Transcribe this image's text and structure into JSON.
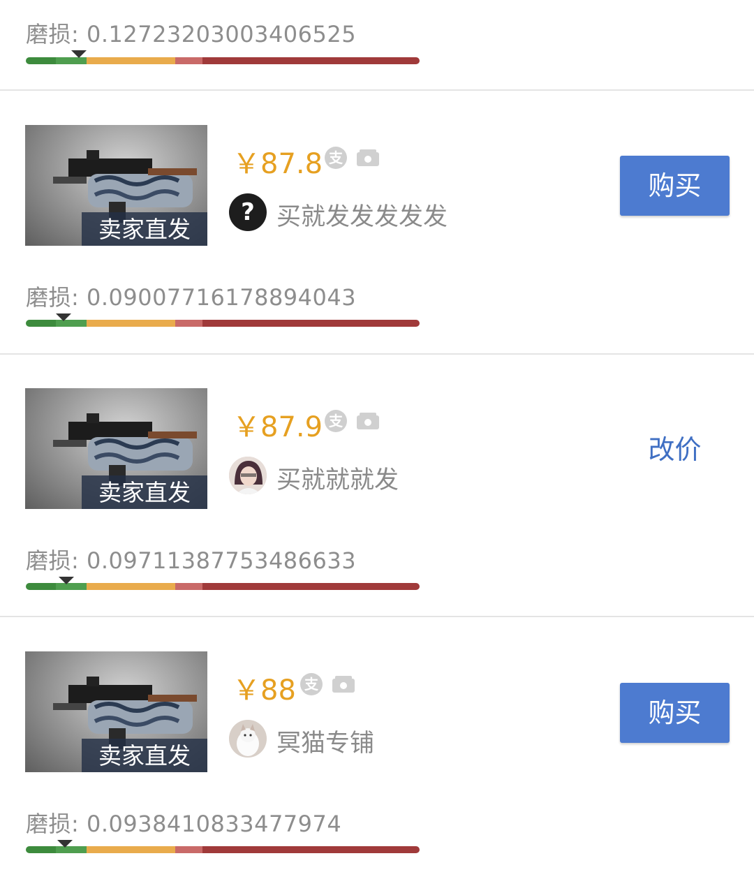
{
  "listings": [
    {
      "wear_label": "磨损: 0.12723203003406525",
      "wear_value": 0.12723203003406525
    },
    {
      "thumb_badge": "卖家直发",
      "price": "￥87.8",
      "pay_icon": "支",
      "seller_icon": "question-icon",
      "seller_name": "买就发发发发发",
      "action_label": "购买",
      "wear_label": "磨损: 0.09007716178894043",
      "wear_value": 0.09007716178894043
    },
    {
      "thumb_badge": "卖家直发",
      "price": "￥87.9",
      "pay_icon": "支",
      "seller_icon": "avatar-girl",
      "seller_name": "买就就就发",
      "action_label": "改价",
      "wear_label": "磨损: 0.09711387753486633",
      "wear_value": 0.09711387753486633
    },
    {
      "thumb_badge": "卖家直发",
      "price": "￥88",
      "pay_icon": "支",
      "seller_icon": "avatar-cat",
      "seller_name": "冥猫专铺",
      "action_label": "购买",
      "wear_label": "磨损: 0.0938410833477974",
      "wear_value": 0.0938410833477974
    }
  ],
  "colors": {
    "price": "#e6a021",
    "buy_button": "#4d7bd0",
    "edit_link": "#3f6fc3",
    "wear_factory_new": "#3d8b3d",
    "wear_minimal_wear": "#4f9e4f",
    "wear_field_tested": "#e9ab4c",
    "wear_well_worn": "#c96a68",
    "wear_battle_scarred": "#a03a3a"
  }
}
